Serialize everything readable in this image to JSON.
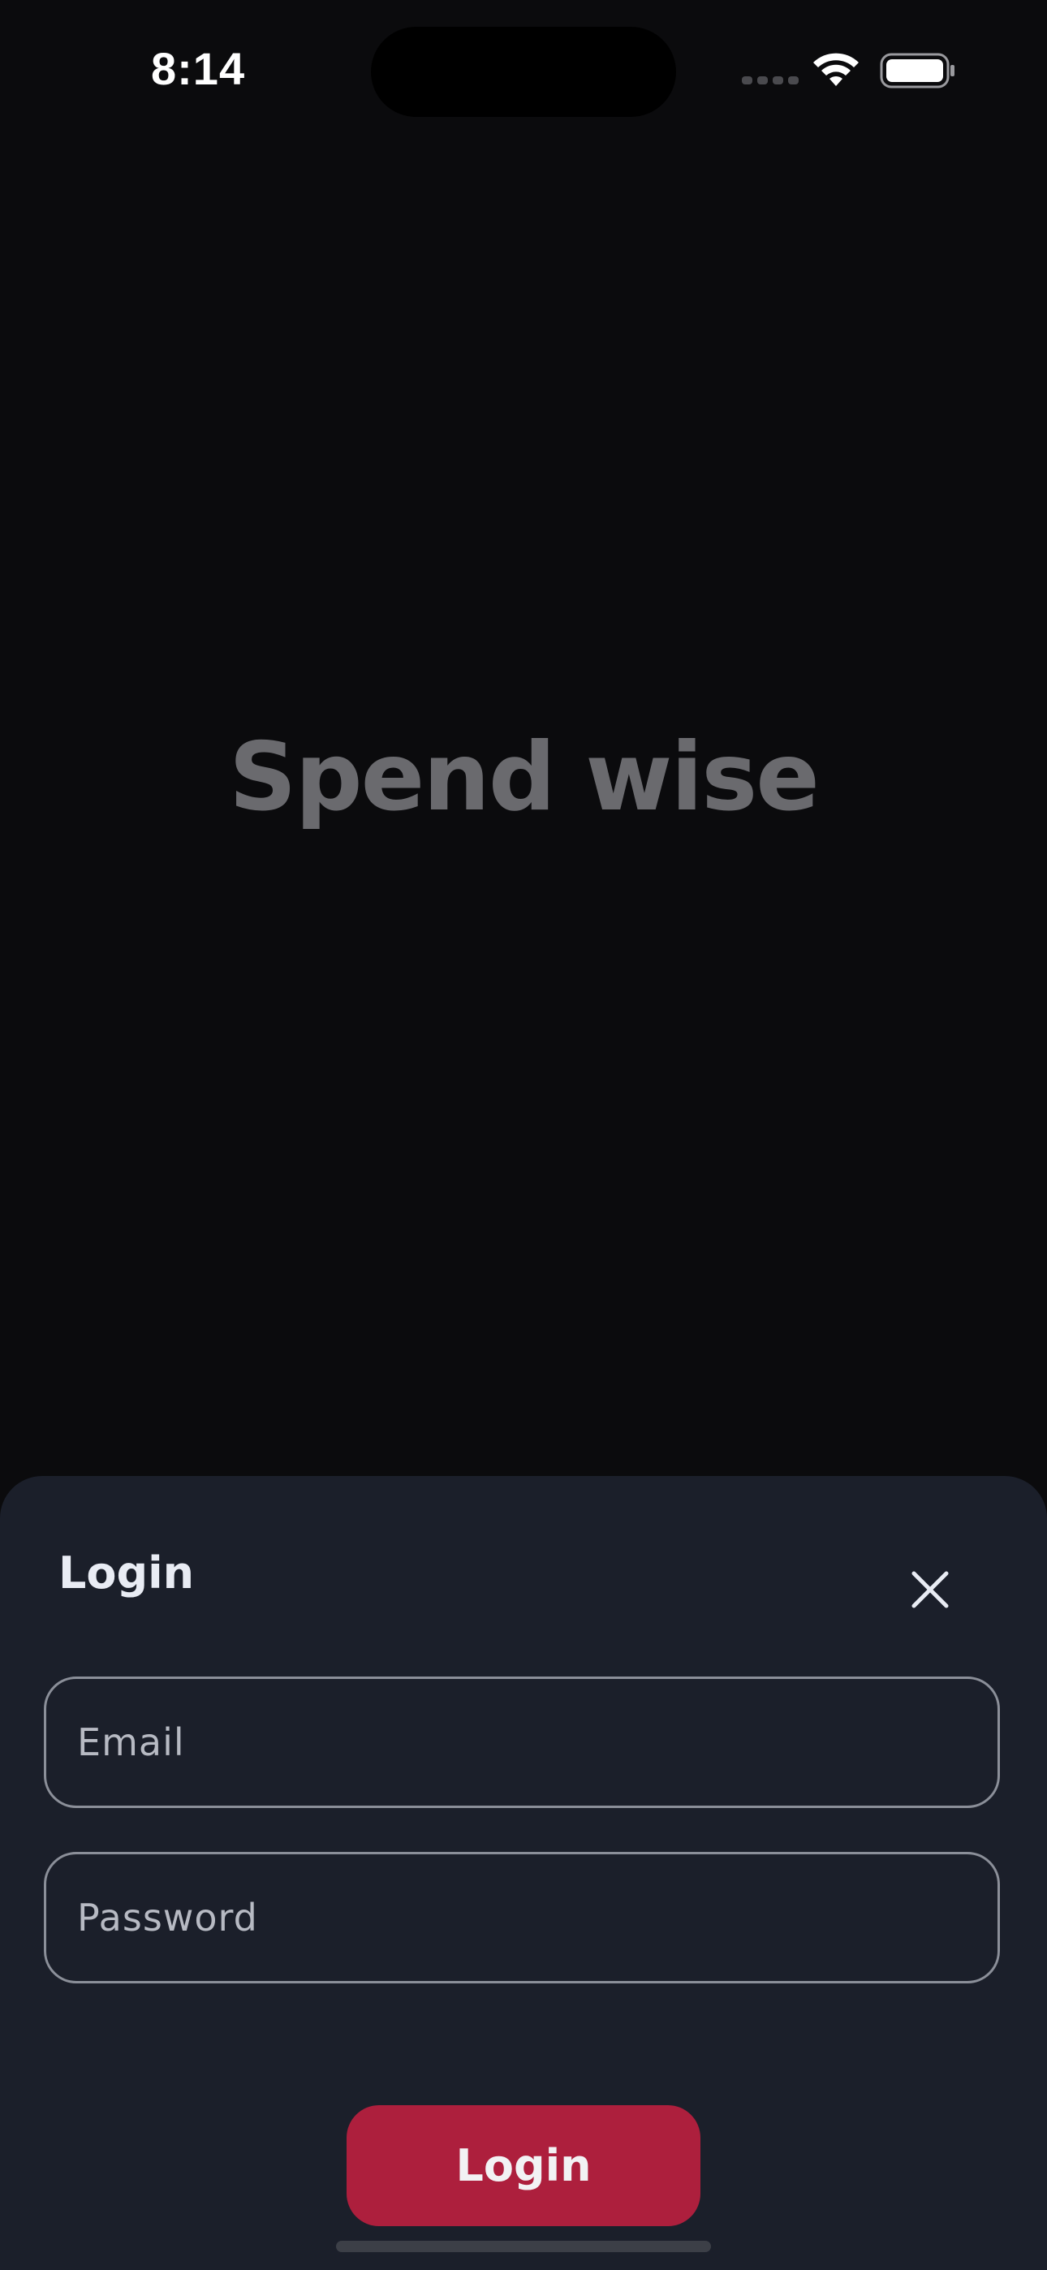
{
  "status_bar": {
    "time": "8:14",
    "icons": [
      "cellular-signal-icon",
      "wifi-icon",
      "battery-icon"
    ]
  },
  "splash": {
    "title": "Spend wise"
  },
  "login_sheet": {
    "title": "Login",
    "close_icon": "close-icon",
    "email": {
      "placeholder": "Email",
      "value": ""
    },
    "password": {
      "placeholder": "Password",
      "value": ""
    },
    "submit_label": "Login"
  },
  "colors": {
    "background": "#0b0b0d",
    "sheet_background": "#1b1f2a",
    "accent": "#ad1f3d",
    "field_border": "#8b8f99",
    "title_muted": "#6a6a6e"
  }
}
